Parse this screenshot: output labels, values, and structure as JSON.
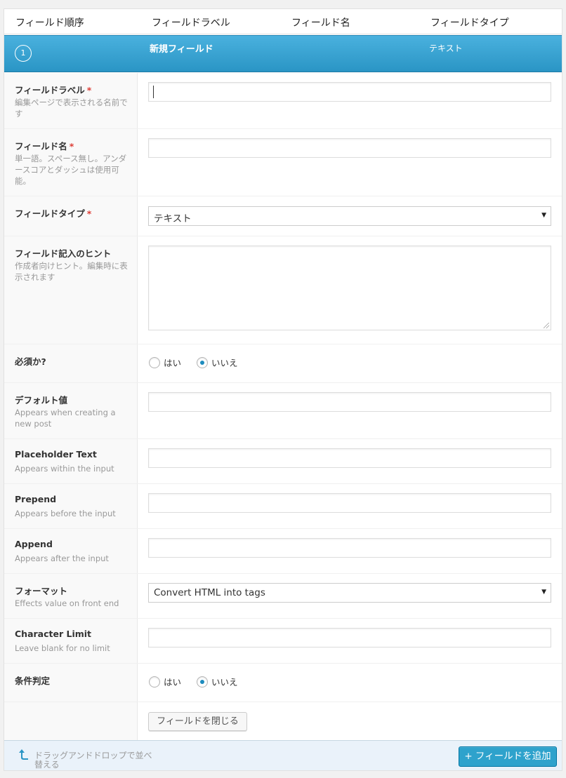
{
  "header": {
    "col_order": "フィールド順序",
    "col_label": "フィールドラベル",
    "col_name": "フィールド名",
    "col_type": "フィールドタイプ"
  },
  "current_field": {
    "order": "1",
    "label": "新規フィールド",
    "type": "テキスト"
  },
  "required_mark": "*",
  "rows": {
    "field_label": {
      "title": "フィールドラベル",
      "desc": "編集ページで表示される名前です",
      "value": ""
    },
    "field_name": {
      "title": "フィールド名",
      "desc": "単一語。スペース無し。アンダースコアとダッシュは使用可能。",
      "value": ""
    },
    "field_type": {
      "title": "フィールドタイプ",
      "selected": "テキスト"
    },
    "instructions": {
      "title": "フィールド記入のヒント",
      "desc": "作成者向けヒント。編集時に表示されます",
      "value": ""
    },
    "required": {
      "title": "必須か?",
      "yes": "はい",
      "no": "いいえ",
      "selected": "no"
    },
    "default_value": {
      "title": "デフォルト値",
      "desc": "Appears when creating a new post",
      "value": ""
    },
    "placeholder": {
      "title": "Placeholder Text",
      "desc": "Appears within the input",
      "value": ""
    },
    "prepend": {
      "title": "Prepend",
      "desc": "Appears before the input",
      "value": ""
    },
    "append": {
      "title": "Append",
      "desc": "Appears after the input",
      "value": ""
    },
    "formatting": {
      "title": "フォーマット",
      "desc": "Effects value on front end",
      "selected": "Convert HTML into tags"
    },
    "char_limit": {
      "title": "Character Limit",
      "desc": "Leave blank for no limit",
      "value": ""
    },
    "conditional": {
      "title": "条件判定",
      "yes": "はい",
      "no": "いいえ",
      "selected": "no"
    }
  },
  "close_button": "フィールドを閉じる",
  "footer": {
    "drag_hint": "ドラッグアンドドロップで並べ替える",
    "add_button": "+ フィールドを追加"
  },
  "colors": {
    "accent_bar": "#2a95c5",
    "add_button": "#2ea2cc",
    "required": "#dd3d36",
    "radio_checked": "#1e8cbe"
  }
}
